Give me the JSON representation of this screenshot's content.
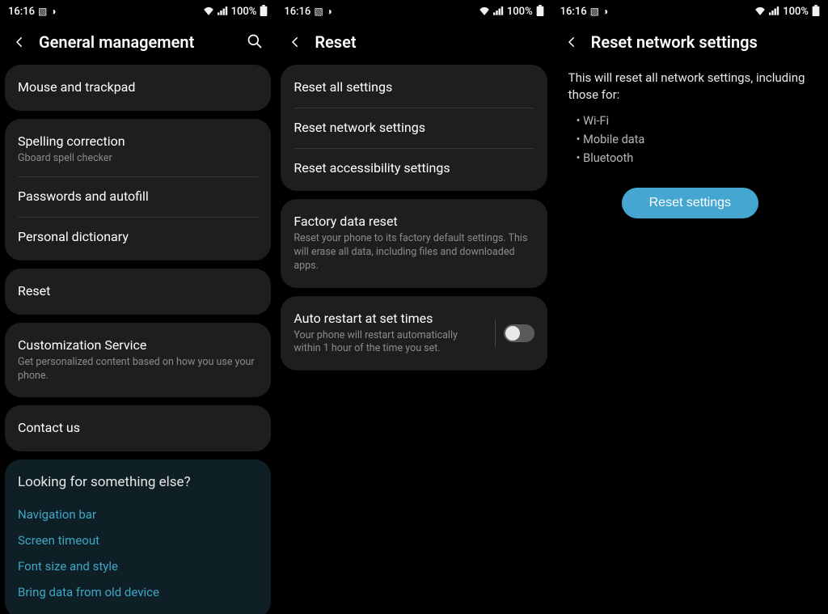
{
  "status": {
    "time": "16:16",
    "battery": "100%"
  },
  "screen1": {
    "title": "General management",
    "items": {
      "mouse": "Mouse and trackpad",
      "spelling": "Spelling correction",
      "spelling_sub": "Gboard spell checker",
      "passwords": "Passwords and autofill",
      "dictionary": "Personal dictionary",
      "reset": "Reset",
      "custom": "Customization Service",
      "custom_sub": "Get personalized content based on how you use your phone.",
      "contact": "Contact us"
    },
    "suggest": {
      "title": "Looking for something else?",
      "links": [
        "Navigation bar",
        "Screen timeout",
        "Font size and style",
        "Bring data from old device"
      ]
    }
  },
  "screen2": {
    "title": "Reset",
    "items": {
      "reset_all": "Reset all settings",
      "reset_net": "Reset network settings",
      "reset_acc": "Reset accessibility settings",
      "factory": "Factory data reset",
      "factory_sub": "Reset your phone to its factory default settings. This will erase all data, including files and downloaded apps.",
      "auto": "Auto restart at set times",
      "auto_sub": "Your phone will restart automatically within 1 hour of the time you set."
    }
  },
  "screen3": {
    "title": "Reset network settings",
    "desc": "This will reset all network settings, including those for:",
    "bullets": [
      "Wi-Fi",
      "Mobile data",
      "Bluetooth"
    ],
    "button": "Reset settings"
  }
}
